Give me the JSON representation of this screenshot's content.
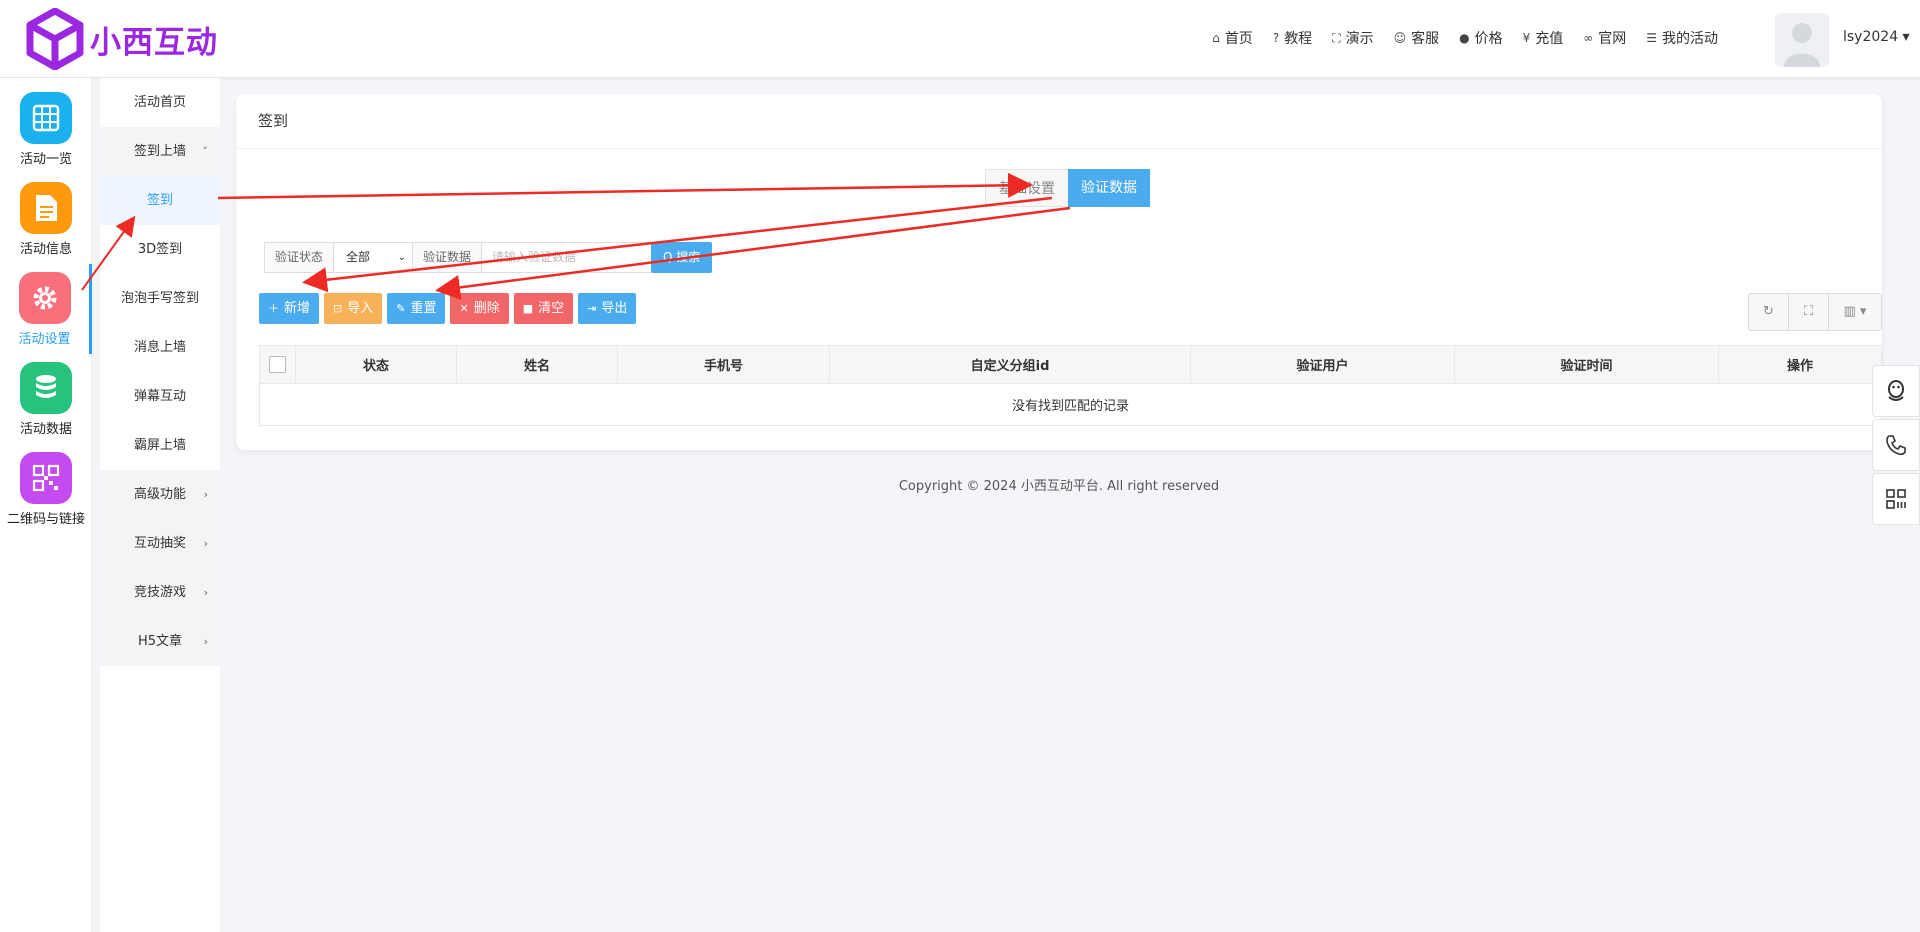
{
  "header": {
    "logo_text": "小西互动",
    "nav": [
      {
        "icon": "home-icon",
        "glyph": "⌂",
        "label": "首页"
      },
      {
        "icon": "help-icon",
        "glyph": "?",
        "label": "教程"
      },
      {
        "icon": "fullscreen-icon",
        "glyph": "⛶",
        "label": "演示"
      },
      {
        "icon": "smile-icon",
        "glyph": "☺",
        "label": "客服"
      },
      {
        "icon": "info-icon",
        "glyph": "●",
        "label": "价格"
      },
      {
        "icon": "yen-icon",
        "glyph": "¥",
        "label": "充值"
      },
      {
        "icon": "link-icon",
        "glyph": "∞",
        "label": "官网"
      },
      {
        "icon": "list-icon",
        "glyph": "☰",
        "label": "我的活动"
      }
    ],
    "username": "lsy2024 ▾"
  },
  "iconbar": {
    "items": [
      {
        "label": "活动一览",
        "color": "#1bb0f0",
        "icon": "grid-icon"
      },
      {
        "label": "活动信息",
        "color": "#ff9a0e",
        "icon": "document-icon"
      },
      {
        "label": "活动设置",
        "color": "#f7707b",
        "icon": "gear-icon"
      },
      {
        "label": "活动数据",
        "color": "#27c27e",
        "icon": "database-icon"
      },
      {
        "label": "二维码与链接",
        "color": "#c34bf0",
        "icon": "qrcode-icon"
      }
    ]
  },
  "subnav": {
    "items": [
      {
        "label": "活动首页",
        "chev": ""
      },
      {
        "label": "签到上墙",
        "chev": "˅"
      },
      {
        "label": "签到",
        "chev": ""
      },
      {
        "label": "3D签到",
        "chev": ""
      },
      {
        "label": "泡泡手写签到",
        "chev": ""
      },
      {
        "label": "消息上墙",
        "chev": ""
      },
      {
        "label": "弹幕互动",
        "chev": ""
      },
      {
        "label": "霸屏上墙",
        "chev": ""
      },
      {
        "label": "高级功能",
        "chev": "›"
      },
      {
        "label": "互动抽奖",
        "chev": "›"
      },
      {
        "label": "竞技游戏",
        "chev": "›"
      },
      {
        "label": "H5文章",
        "chev": "›"
      }
    ]
  },
  "main": {
    "title": "签到",
    "tabs": {
      "settings": "基础设置",
      "verify_data": "验证数据"
    },
    "filter": {
      "status_label": "验证状态",
      "status_value": "全部",
      "data_label": "验证数据",
      "data_placeholder": "请输入验证数据",
      "search_label": "Q 搜索"
    },
    "toolbar": {
      "add": "新增",
      "import": "导入",
      "reset": "重置",
      "delete": "删除",
      "clear": "清空",
      "export": "导出"
    },
    "table": {
      "headers": [
        "状态",
        "姓名",
        "手机号",
        "自定义分组id",
        "验证用户",
        "验证时间",
        "操作"
      ],
      "empty": "没有找到匹配的记录"
    }
  },
  "footer": {
    "copyright": "Copyright © 2024 小西互动平台. All right reserved"
  },
  "annotation_color": "#ee2a24"
}
